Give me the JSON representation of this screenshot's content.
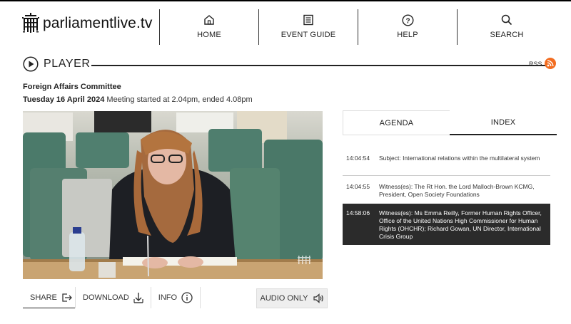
{
  "site": {
    "logo_text": "parliamentlive.tv"
  },
  "nav": [
    {
      "label": "HOME",
      "icon": "home-icon"
    },
    {
      "label": "EVENT GUIDE",
      "icon": "guide-icon"
    },
    {
      "label": "HELP",
      "icon": "help-icon"
    },
    {
      "label": "SEARCH",
      "icon": "search-icon"
    }
  ],
  "player": {
    "title": "PLAYER",
    "rss_label": "RSS"
  },
  "meeting": {
    "committee": "Foreign Affairs Committee",
    "date": "Tuesday 16 April 2024",
    "times": "Meeting started at 2.04pm, ended 4.08pm"
  },
  "controls": {
    "share": "SHARE",
    "download": "DOWNLOAD",
    "info": "INFO",
    "audio_only": "AUDIO ONLY"
  },
  "tabs": {
    "agenda": "AGENDA",
    "index": "INDEX",
    "active": "INDEX"
  },
  "index_entries": [
    {
      "time": "14:04:54",
      "text": "Subject: International relations within the multilateral system",
      "active": false
    },
    {
      "time": "14:04:55",
      "text": "Witness(es): The Rt Hon. the Lord Malloch-Brown KCMG, President, Open Society Foundations",
      "active": false
    },
    {
      "time": "14:58:06",
      "text": "Witness(es): Ms Emma Reilly, Former Human Rights Officer, Office of the United Nations High Commissioner for Human Rights (OHCHR); Richard Gowan, UN Director, International Crisis Group",
      "active": true
    }
  ],
  "colors": {
    "rss": "#f26d21",
    "active_row": "#2b2b2b"
  }
}
